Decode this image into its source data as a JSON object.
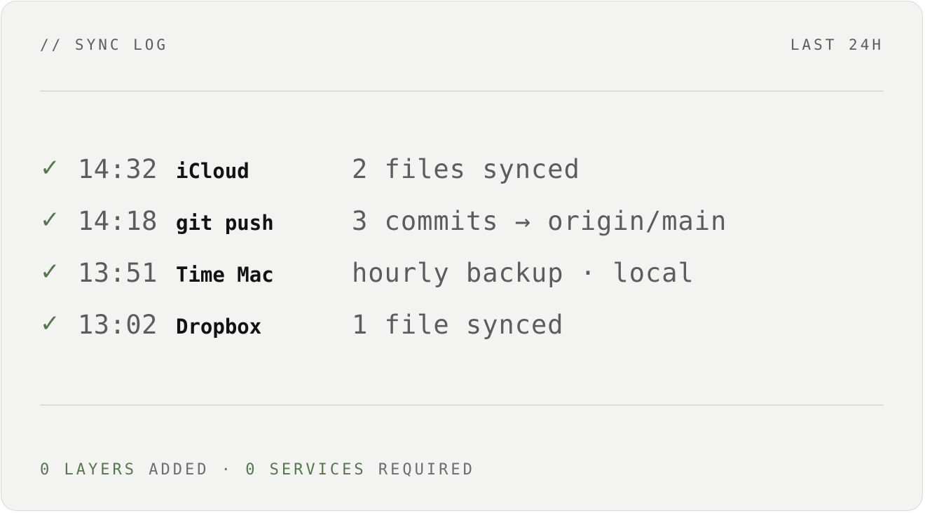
{
  "header": {
    "title": "// SYNC LOG",
    "range": "LAST 24H"
  },
  "log": [
    {
      "status_icon": "check-icon",
      "time": "14:32",
      "service": "iCloud",
      "detail": "2 files synced"
    },
    {
      "status_icon": "check-icon",
      "time": "14:18",
      "service": "git push",
      "detail": "3 commits → origin/main"
    },
    {
      "status_icon": "check-icon",
      "time": "13:51",
      "service": "Time Mac",
      "detail": "hourly backup · local"
    },
    {
      "status_icon": "check-icon",
      "time": "13:02",
      "service": "Dropbox",
      "detail": "1 file synced"
    }
  ],
  "footer": {
    "layers_count": "0 LAYERS",
    "layers_label": " ADDED · ",
    "services_count": "0 SERVICES",
    "services_label": " REQUIRED"
  },
  "colors": {
    "background": "#f3f3f1",
    "accent_green": "#587451",
    "text_gray": "#5a5c5f",
    "text_dark": "#111214"
  }
}
